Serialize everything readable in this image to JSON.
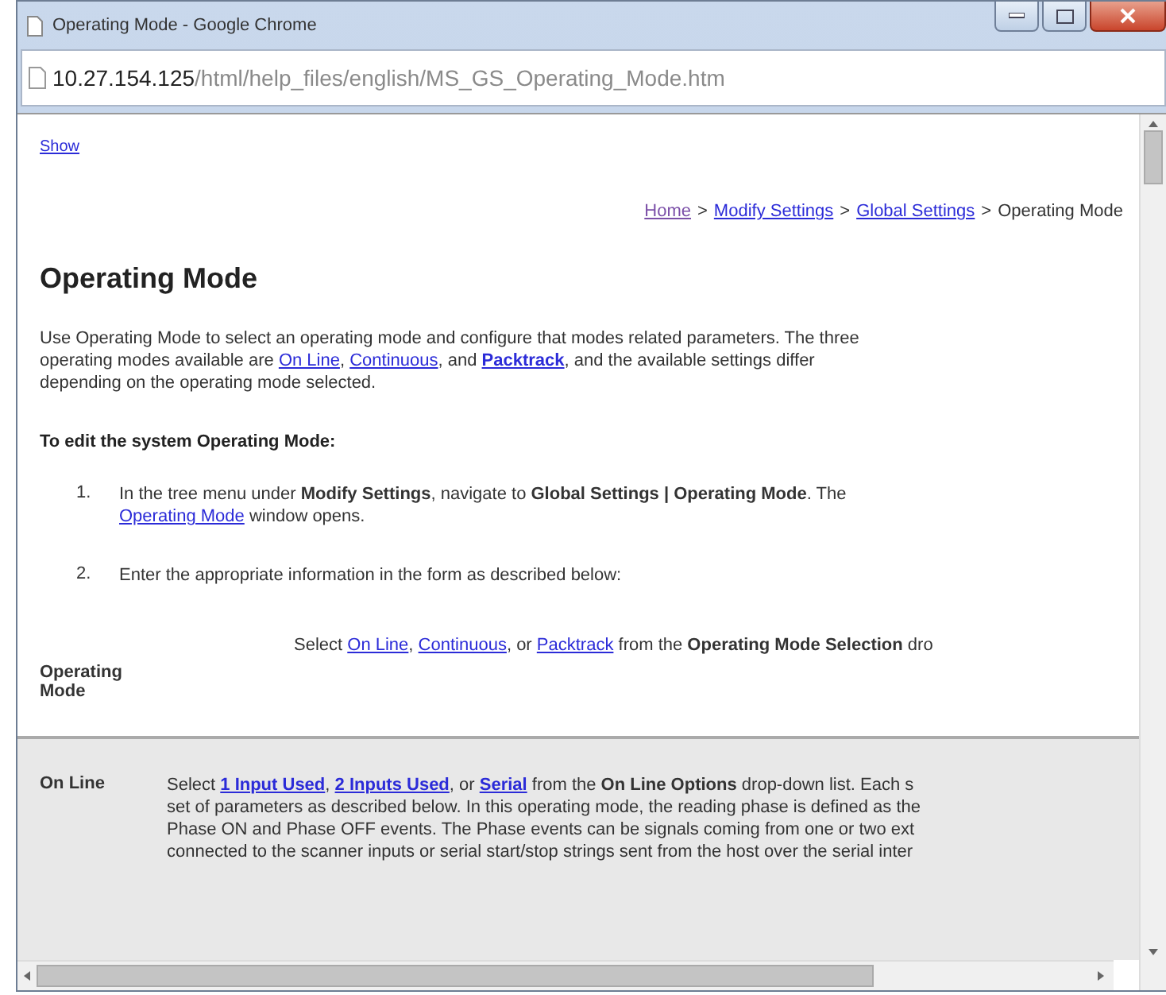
{
  "window": {
    "title": "Operating Mode - Google Chrome"
  },
  "address_bar": {
    "host": "10.27.154.125",
    "path": "/html/help_files/english/MS_GS_Operating_Mode.htm"
  },
  "page": {
    "show_link": "Show",
    "breadcrumb": [
      {
        "kind": "visited_link",
        "text": "Home"
      },
      {
        "kind": "separator",
        "text": ">"
      },
      {
        "kind": "link",
        "text": "Modify Settings"
      },
      {
        "kind": "separator",
        "text": ">"
      },
      {
        "kind": "link",
        "text": "Global Settings"
      },
      {
        "kind": "separator",
        "text": ">"
      },
      {
        "kind": "current",
        "text": "Operating Mode"
      }
    ],
    "heading": "Operating Mode",
    "intro": [
      [
        {
          "kind": "text",
          "text": "Use Operating Mode to select an operating mode and configure that modes related parameters. The three"
        }
      ],
      [
        {
          "kind": "text",
          "text": "operating modes available are "
        },
        {
          "kind": "link",
          "text": "On Line"
        },
        {
          "kind": "text",
          "text": ", "
        },
        {
          "kind": "link",
          "text": "Continuous"
        },
        {
          "kind": "text",
          "text": ", and "
        },
        {
          "kind": "strong_link",
          "text": "Packtrack"
        },
        {
          "kind": "text",
          "text": ", and the available settings differ"
        }
      ],
      [
        {
          "kind": "text",
          "text": "depending on the operating mode selected."
        }
      ]
    ],
    "procedure_title": "To edit the system Operating Mode:",
    "steps": [
      {
        "number": "1.",
        "lines": [
          [
            {
              "kind": "text",
              "text": "In the tree menu under "
            },
            {
              "kind": "bold",
              "text": "Modify Settings"
            },
            {
              "kind": "text",
              "text": ", navigate to "
            },
            {
              "kind": "bold",
              "text": "Global Settings | Operating Mode"
            },
            {
              "kind": "text",
              "text": ". The"
            }
          ],
          [
            {
              "kind": "link",
              "text": "Operating Mode"
            },
            {
              "kind": "text",
              "text": " window opens."
            }
          ]
        ]
      },
      {
        "number": "2.",
        "lines": [
          [
            {
              "kind": "text",
              "text": "Enter the appropriate information in the form as described below:"
            }
          ]
        ]
      }
    ],
    "table": [
      {
        "label": "Operating Mode",
        "shaded": false,
        "lines": [
          [
            {
              "kind": "text",
              "text": "Select "
            },
            {
              "kind": "link",
              "text": "On Line"
            },
            {
              "kind": "text",
              "text": ", "
            },
            {
              "kind": "link",
              "text": "Continuous"
            },
            {
              "kind": "text",
              "text": ", or "
            },
            {
              "kind": "link",
              "text": "Packtrack"
            },
            {
              "kind": "text",
              "text": " from the "
            },
            {
              "kind": "bold",
              "text": "Operating Mode Selection"
            },
            {
              "kind": "text",
              "text": " dro"
            }
          ]
        ]
      },
      {
        "label": "On Line",
        "shaded": true,
        "lines": [
          [
            {
              "kind": "text",
              "text": "Select "
            },
            {
              "kind": "strong_link",
              "text": "1 Input Used"
            },
            {
              "kind": "text",
              "text": ", "
            },
            {
              "kind": "strong_link",
              "text": "2 Inputs Used"
            },
            {
              "kind": "text",
              "text": ", or "
            },
            {
              "kind": "strong_link",
              "text": "Serial"
            },
            {
              "kind": "text",
              "text": " from the "
            },
            {
              "kind": "bold",
              "text": "On Line Options"
            },
            {
              "kind": "text",
              "text": " drop-down list. Each s"
            }
          ],
          [
            {
              "kind": "text",
              "text": "set of parameters as described below. In this operating mode, the reading phase is defined as the"
            }
          ],
          [
            {
              "kind": "text",
              "text": "Phase ON and Phase OFF events. The Phase events can be signals coming from one or two ext"
            }
          ],
          [
            {
              "kind": "text",
              "text": "connected to the scanner inputs or serial start/stop strings sent from the host over the serial inter"
            }
          ]
        ]
      }
    ]
  }
}
